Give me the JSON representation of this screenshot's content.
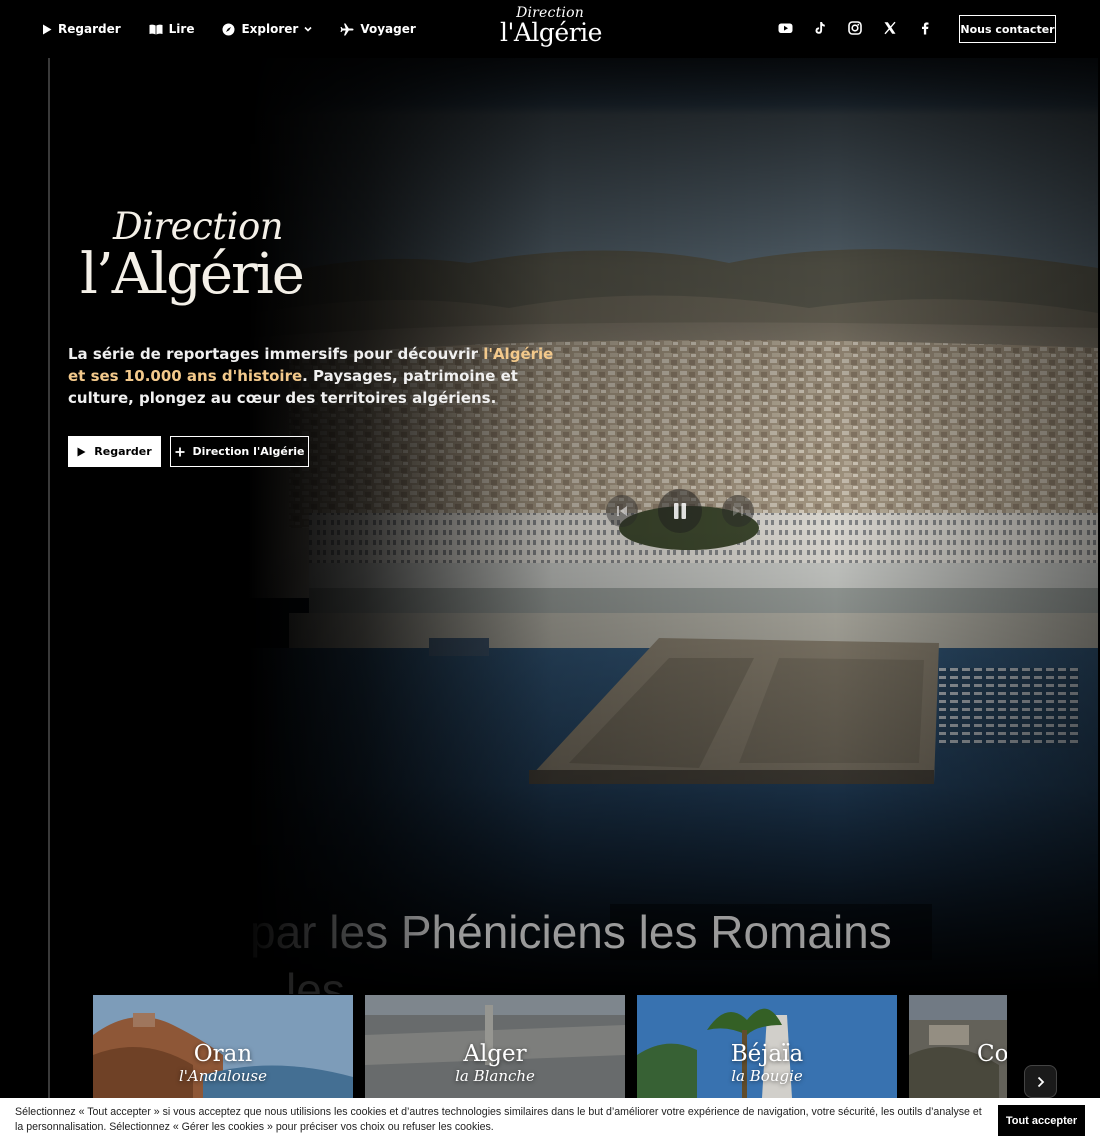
{
  "nav": {
    "watch": "Regarder",
    "read": "Lire",
    "explore": "Explorer",
    "travel": "Voyager",
    "contact": "Nous contacter"
  },
  "brand": {
    "line1": "Direction",
    "line2": "l'Algérie"
  },
  "socials": [
    "youtube-icon",
    "tiktok-icon",
    "instagram-icon",
    "x-icon",
    "facebook-icon"
  ],
  "hero": {
    "logo_line1": "Direction",
    "logo_line2": "l’Algérie",
    "text_before": "La série de reportages immersifs pour découvrir ",
    "text_highlight": "l'Algérie et ses 10.000 ans d'histoire",
    "text_after": ". Paysages, patrimoine et culture, plongez au cœur des territoires algériens.",
    "watch_button": "Regarder",
    "direction_button": "Direction l'Algérie",
    "ticker": "par les Phéniciens les Romains",
    "ticker_sub": "les"
  },
  "cards": [
    {
      "name": "Oran",
      "sub": "l'Andalouse"
    },
    {
      "name": "Alger",
      "sub": "la Blanche"
    },
    {
      "name": "Béjaïa",
      "sub": "la Bougie"
    },
    {
      "name": "Co",
      "sub": ""
    }
  ],
  "cookie": {
    "text": "Sélectionnez « Tout accepter » si vous acceptez que nous utilisions les cookies et d’autres technologies similaires dans le but d’améliorer votre expérience de navigation, votre sécurité, les outils d’analyse et la personnalisation. Sélectionnez « Gérer les cookies » pour préciser vos choix ou refuser les cookies.",
    "accept": "Tout accepter"
  },
  "colors": {
    "accent": "#f3c98b",
    "background": "#000000",
    "banner": "#ffffff"
  }
}
